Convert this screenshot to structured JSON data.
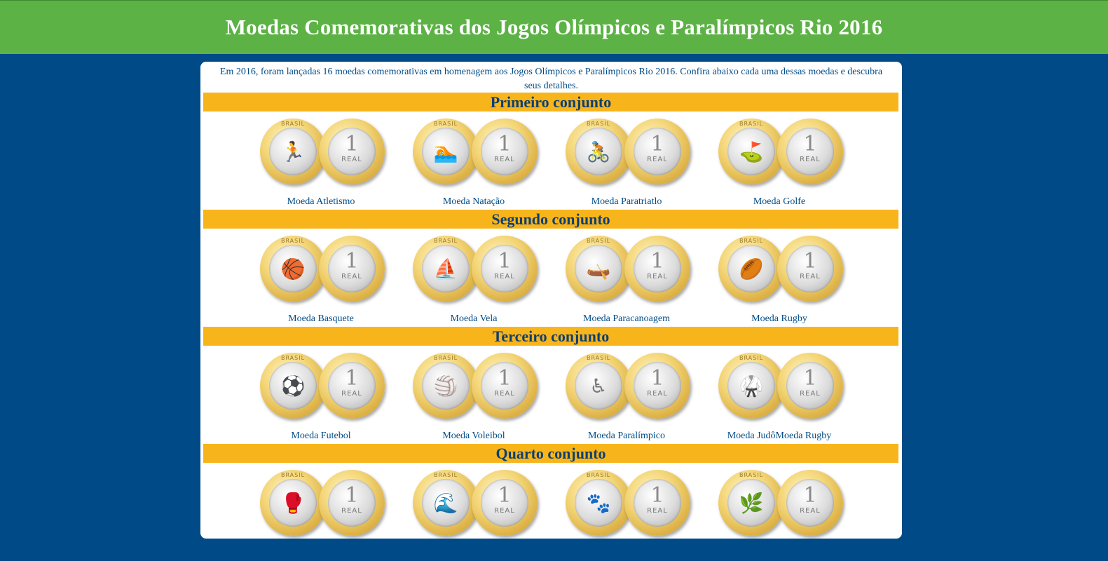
{
  "header": {
    "title": "Moedas Comemorativas dos Jogos Olímpicos e Paralímpicos Rio 2016"
  },
  "intro": "Em 2016, foram lançadas 16 moedas comemorativas em homenagem aos Jogos Olímpicos e Paralímpicos Rio 2016. Confira abaixo cada uma dessas moedas e descubra seus detalhes.",
  "coin_back": {
    "brand": "BRASIL",
    "value": "1",
    "unit": "REAL"
  },
  "sets": [
    {
      "title": "Primeiro conjunto",
      "coins": [
        {
          "label": "Moeda Atletismo",
          "icon": "runner-icon"
        },
        {
          "label": "Moeda Natação",
          "icon": "swimmer-icon"
        },
        {
          "label": "Moeda Paratriatlo",
          "icon": "cyclist-icon"
        },
        {
          "label": "Moeda Golfe",
          "icon": "golf-icon"
        }
      ]
    },
    {
      "title": "Segundo conjunto",
      "coins": [
        {
          "label": "Moeda Basquete",
          "icon": "basketball-icon"
        },
        {
          "label": "Moeda Vela",
          "icon": "sailboat-icon"
        },
        {
          "label": "Moeda Paracanoagem",
          "icon": "canoe-icon"
        },
        {
          "label": "Moeda Rugby",
          "icon": "rugby-icon"
        }
      ]
    },
    {
      "title": "Terceiro conjunto",
      "coins": [
        {
          "label": "Moeda Futebol",
          "icon": "soccer-icon"
        },
        {
          "label": "Moeda Voleibol",
          "icon": "volleyball-icon"
        },
        {
          "label": "Moeda Paralímpico",
          "icon": "para-runner-icon"
        },
        {
          "label": "Moeda JudôMoeda Rugby",
          "icon": "judo-icon"
        }
      ]
    },
    {
      "title": "Quarto conjunto",
      "coins": [
        {
          "label": "",
          "icon": "boxing-icon"
        },
        {
          "label": "",
          "icon": "swimming-lane-icon"
        },
        {
          "label": "",
          "icon": "mascot-vinicius-icon"
        },
        {
          "label": "",
          "icon": "mascot-tom-icon"
        }
      ]
    }
  ]
}
